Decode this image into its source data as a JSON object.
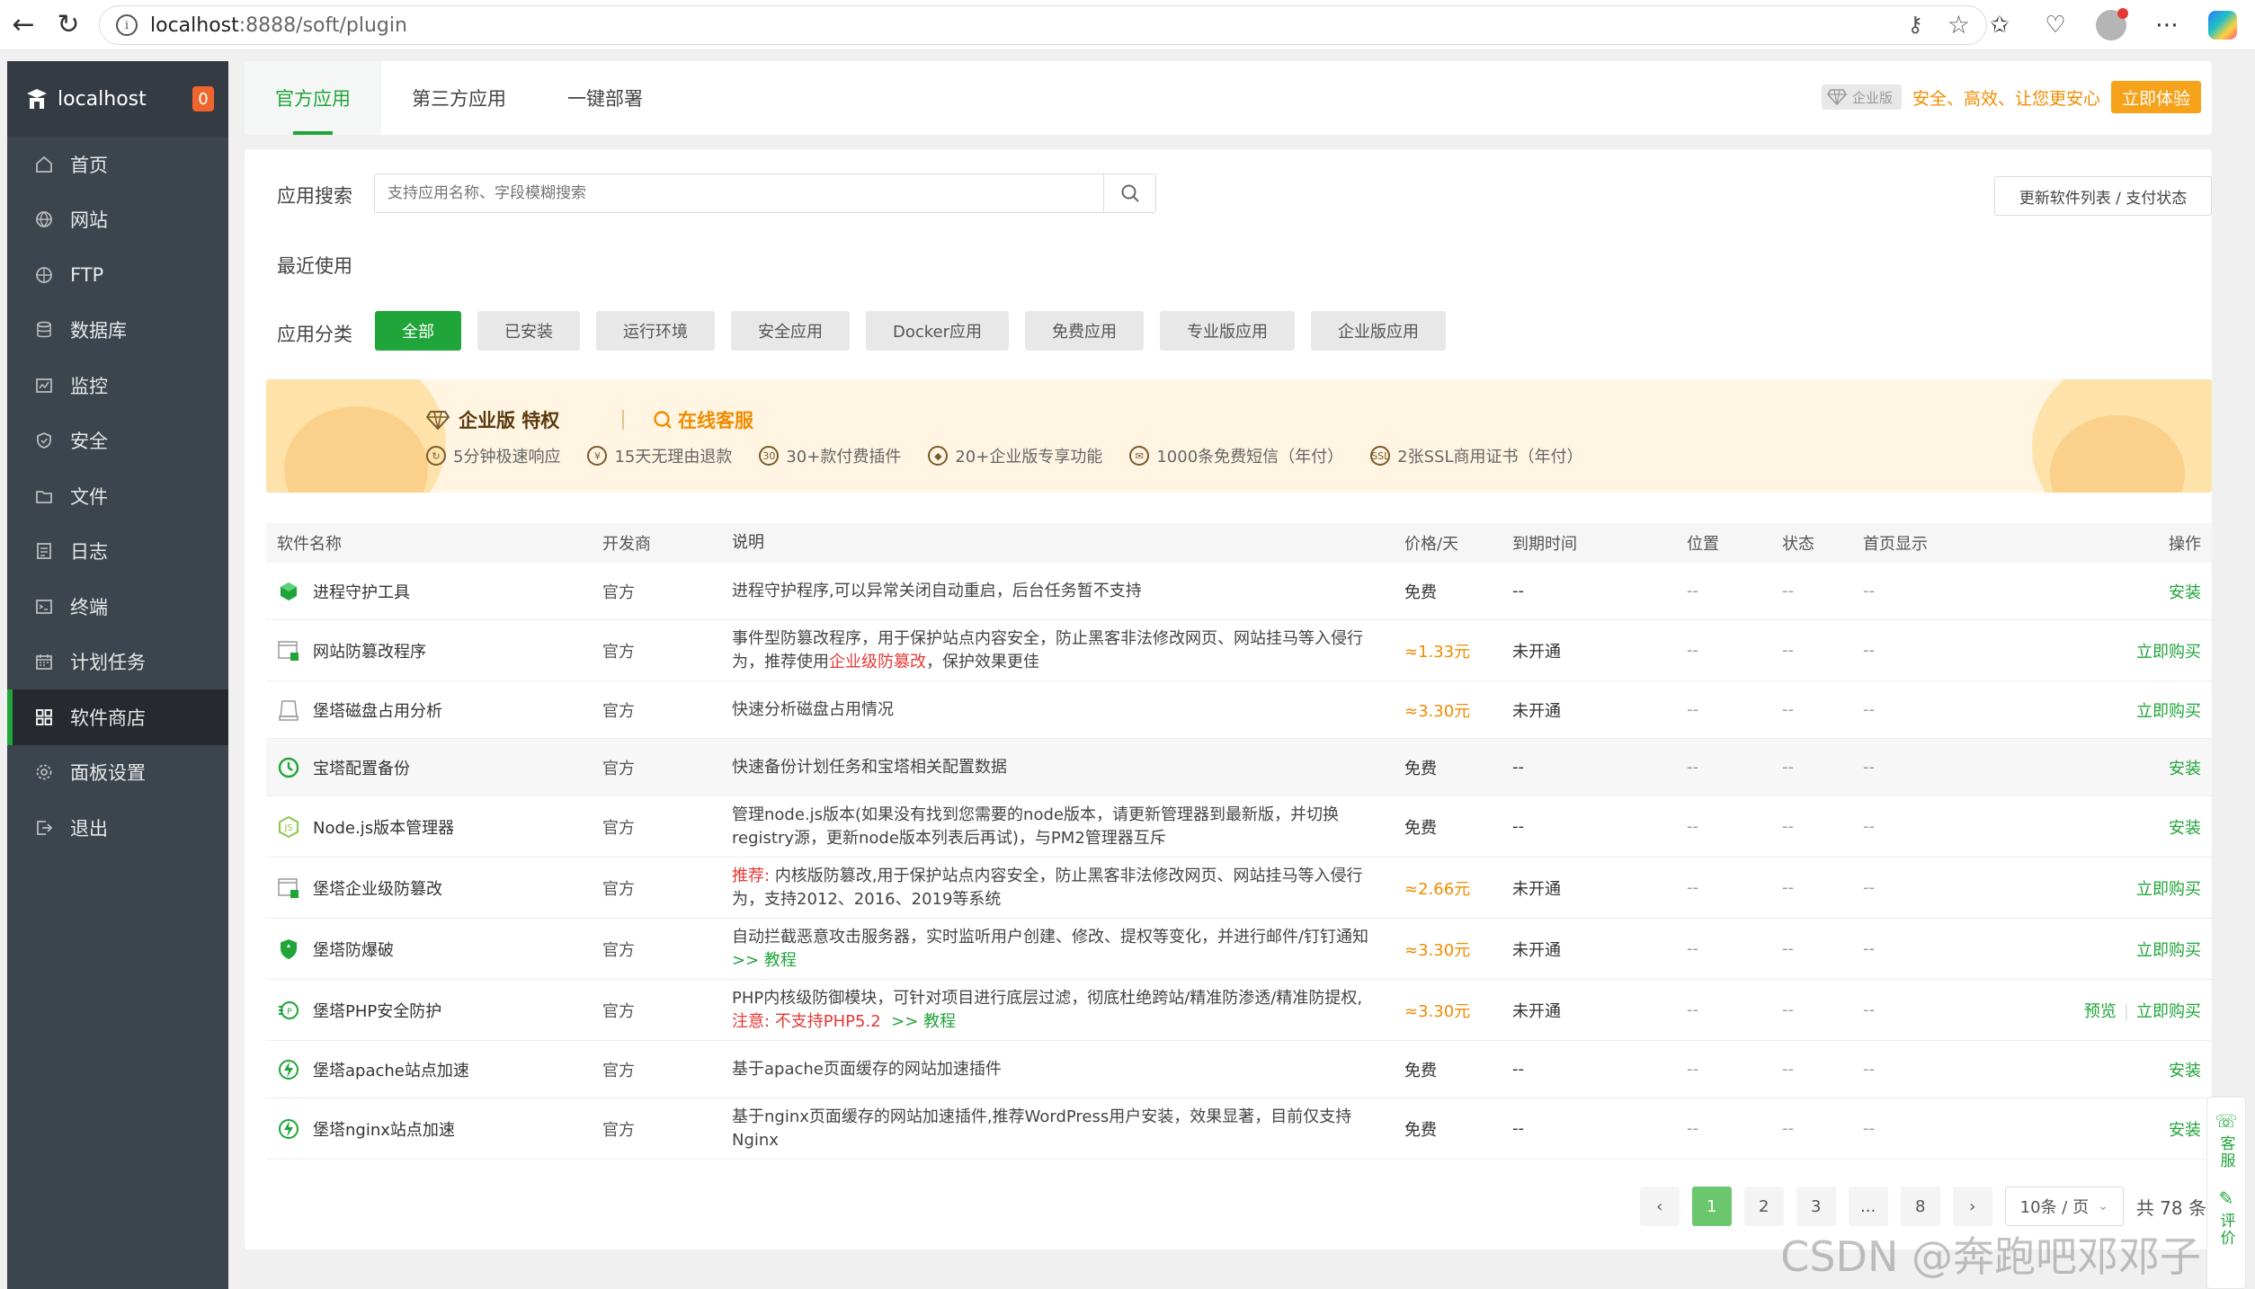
{
  "browser": {
    "url_host": "localhost",
    "url_path": ":8888/soft/plugin"
  },
  "sidebar": {
    "title": "localhost",
    "badge": "0",
    "items": [
      {
        "label": "首页",
        "icon": "home-icon"
      },
      {
        "label": "网站",
        "icon": "globe-icon"
      },
      {
        "label": "FTP",
        "icon": "ftp-icon"
      },
      {
        "label": "数据库",
        "icon": "database-icon"
      },
      {
        "label": "监控",
        "icon": "monitor-icon"
      },
      {
        "label": "安全",
        "icon": "shield-icon"
      },
      {
        "label": "文件",
        "icon": "folder-icon"
      },
      {
        "label": "日志",
        "icon": "log-icon"
      },
      {
        "label": "终端",
        "icon": "terminal-icon"
      },
      {
        "label": "计划任务",
        "icon": "calendar-icon"
      },
      {
        "label": "软件商店",
        "icon": "grid-icon",
        "active": true
      },
      {
        "label": "面板设置",
        "icon": "gear-icon"
      },
      {
        "label": "退出",
        "icon": "logout-icon"
      }
    ]
  },
  "tabs": [
    {
      "label": "官方应用",
      "active": true
    },
    {
      "label": "第三方应用"
    },
    {
      "label": "一键部署"
    }
  ],
  "promo": {
    "chip": "企业版",
    "text": "安全、高效、让您更安心",
    "button": "立即体验"
  },
  "search": {
    "label": "应用搜索",
    "placeholder": "支持应用名称、字段模糊搜索",
    "refresh": "更新软件列表 / 支付状态"
  },
  "recent_label": "最近使用",
  "categories": {
    "label": "应用分类",
    "items": [
      "全部",
      "已安装",
      "运行环境",
      "安全应用",
      "Docker应用",
      "免费应用",
      "专业版应用",
      "企业版应用"
    ]
  },
  "banner": {
    "title": "企业版 特权",
    "service": "在线客服",
    "features": [
      "5分钟极速响应",
      "15天无理由退款",
      "30+款付费插件",
      "20+企业版专享功能",
      "1000条免费短信（年付）",
      "2张SSL商用证书（年付）"
    ]
  },
  "table": {
    "headers": {
      "name": "软件名称",
      "dev": "开发商",
      "desc": "说明",
      "price": "价格/天",
      "exp": "到期时间",
      "loc": "位置",
      "stat": "状态",
      "home": "首页显示",
      "op": "操作"
    },
    "rows": [
      {
        "name": "进程守护工具",
        "dev": "官方",
        "desc": "进程守护程序,可以异常关闭自动重启，后台任务暂不支持",
        "price": "免费",
        "exp": "--",
        "loc": "--",
        "stat": "--",
        "home": "--",
        "op": "安装"
      },
      {
        "name": "网站防篡改程序",
        "dev": "官方",
        "desc1": "事件型防篡改程序，用于保护站点内容安全，防止黑客非法修改网页、网站挂马等入侵行为，推荐使用",
        "desc_link": "企业级防篡改",
        "desc2": "，保护效果更佳",
        "price": "≈1.33元",
        "exp": "未开通",
        "loc": "--",
        "stat": "--",
        "home": "--",
        "op": "立即购买"
      },
      {
        "name": "堡塔磁盘占用分析",
        "dev": "官方",
        "desc": "快速分析磁盘占用情况",
        "price": "≈3.30元",
        "exp": "未开通",
        "loc": "--",
        "stat": "--",
        "home": "--",
        "op": "立即购买"
      },
      {
        "name": "宝塔配置备份",
        "dev": "官方",
        "desc": "快速备份计划任务和宝塔相关配置数据",
        "price": "免费",
        "exp": "--",
        "loc": "--",
        "stat": "--",
        "home": "--",
        "op": "安装"
      },
      {
        "name": "Node.js版本管理器",
        "dev": "官方",
        "desc": "管理node.js版本(如果没有找到您需要的node版本，请更新管理器到最新版，并切换registry源，更新node版本列表后再试)，与PM2管理器互斥",
        "price": "免费",
        "exp": "--",
        "loc": "--",
        "stat": "--",
        "home": "--",
        "op": "安装"
      },
      {
        "name": "堡塔企业级防篡改",
        "dev": "官方",
        "desc_tag": "推荐:",
        "desc": "内核版防篡改,用于保护站点内容安全，防止黑客非法修改网页、网站挂马等入侵行为，支持2012、2016、2019等系统",
        "price": "≈2.66元",
        "exp": "未开通",
        "loc": "--",
        "stat": "--",
        "home": "--",
        "op": "立即购买"
      },
      {
        "name": "堡塔防爆破",
        "dev": "官方",
        "desc": "自动拦截恶意攻击服务器，实时监听用户创建、修改、提权等变化，并进行邮件/钉钉通知",
        "desc_more": ">> 教程",
        "price": "≈3.30元",
        "exp": "未开通",
        "loc": "--",
        "stat": "--",
        "home": "--",
        "op": "立即购买"
      },
      {
        "name": "堡塔PHP安全防护",
        "dev": "官方",
        "desc": "PHP内核级防御模块，可针对项目进行底层过滤，彻底杜绝跨站/精准防渗透/精准防提权,",
        "desc_note": "注意: 不支持PHP5.2",
        "desc_more": ">> 教程",
        "price": "≈3.30元",
        "exp": "未开通",
        "loc": "--",
        "stat": "--",
        "home": "--",
        "op_preview": "预览",
        "op": "立即购买"
      },
      {
        "name": "堡塔apache站点加速",
        "dev": "官方",
        "desc": "基于apache页面缓存的网站加速插件",
        "price": "免费",
        "exp": "--",
        "loc": "--",
        "stat": "--",
        "home": "--",
        "op": "安装"
      },
      {
        "name": "堡塔nginx站点加速",
        "dev": "官方",
        "desc": "基于nginx页面缓存的网站加速插件,推荐WordPress用户安装，效果显著，目前仅支持Nginx",
        "price": "免费",
        "exp": "--",
        "loc": "--",
        "stat": "--",
        "home": "--",
        "op": "安装"
      }
    ]
  },
  "pagination": {
    "pages": [
      "1",
      "2",
      "3",
      "...",
      "8"
    ],
    "size": "10条 / 页",
    "total": "共 78 条"
  },
  "float": {
    "service": "客服",
    "review": "评价"
  },
  "watermark": "CSDN @奔跑吧邓邓子"
}
